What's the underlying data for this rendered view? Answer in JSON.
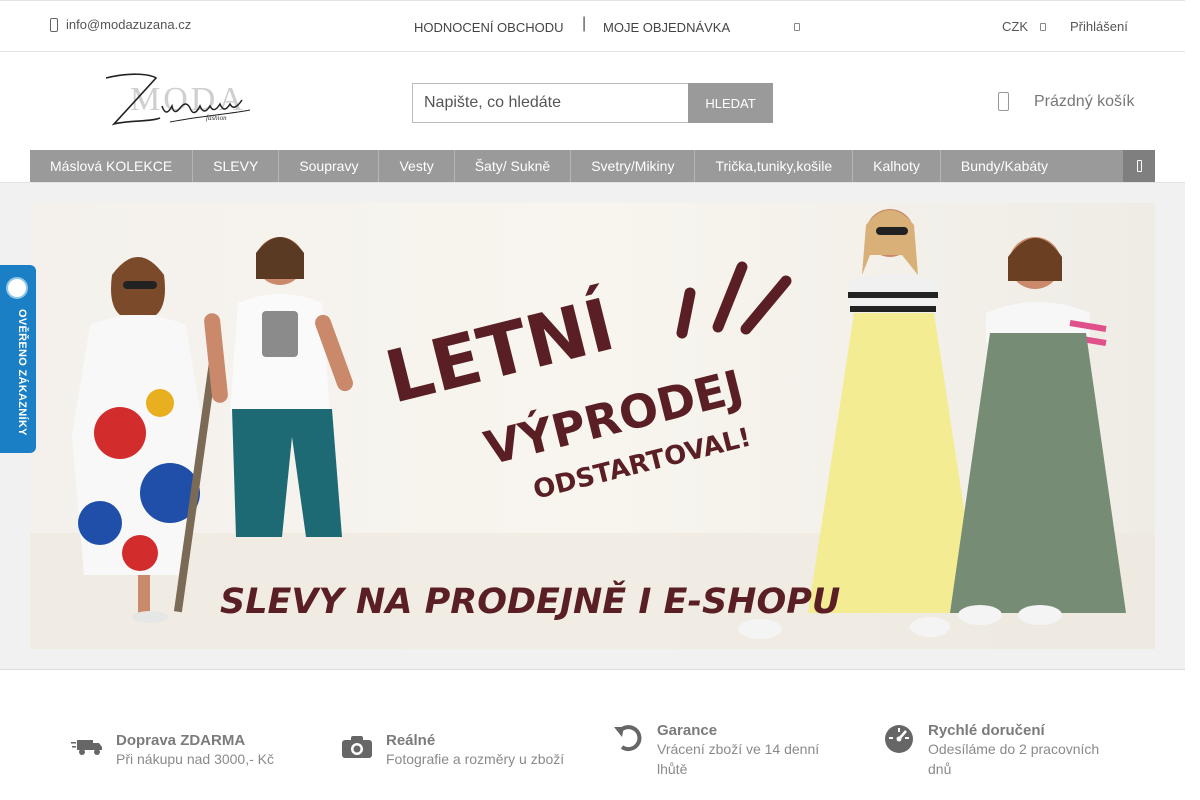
{
  "topbar": {
    "email": "info@modazuzana.cz",
    "rating_link": "HODNOCENÍ OBCHODU",
    "order_link": "MOJE OBJEDNÁVKA",
    "currency": "CZK",
    "login": "Přihlášení"
  },
  "header": {
    "search_placeholder": "Napište, co hledáte",
    "search_button": "HLEDAT",
    "cart_label": "Prázdný košík"
  },
  "menu": {
    "items": [
      "Máslová KOLEKCE",
      "SLEVY",
      "Soupravy",
      "Vesty",
      "Šaty/ Sukně",
      "Svetry/Mikiny",
      "Trička,tuniky,košile",
      "Kalhoty",
      "Bundy/Kabáty"
    ]
  },
  "banner": {
    "line1": "LETNÍ",
    "line2": "VÝPRODEJ",
    "line3": "ODSTARTOVAL!",
    "line4": "SLEVY NA PRODEJNĚ I E-SHOPU"
  },
  "verified": {
    "label": "OVĚŘENO ZÁKAZNÍKY"
  },
  "features": [
    {
      "title": "Doprava ZDARMA",
      "text": "Při nákupu nad 3000,- Kč",
      "icon": "truck-icon"
    },
    {
      "title": "Reálné",
      "text": "Fotografie a rozměry u zboží",
      "icon": "camera-icon"
    },
    {
      "title": "Garance",
      "text": "Vrácení zboží ve 14 denní lhůtě",
      "icon": "return-icon"
    },
    {
      "title": "Rychlé doručení",
      "text": "Odesíláme do 2 pracovních dnů",
      "icon": "speedometer-icon"
    }
  ],
  "colors": {
    "menu_bg": "#9a9a9a",
    "banner_bg": "#f7f3ec",
    "banner_text": "#5a1f24",
    "verified_blue": "#1a7fc4"
  }
}
